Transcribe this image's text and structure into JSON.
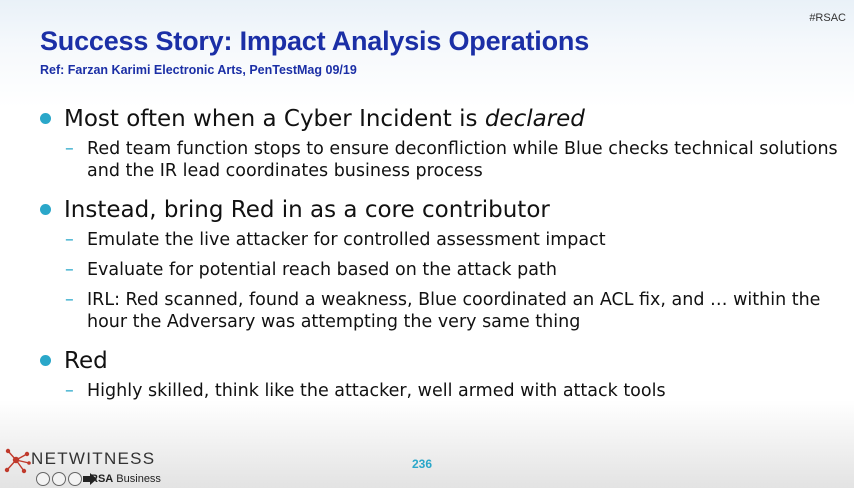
{
  "header": {
    "hashtag": "#RSAC",
    "title": "Success Story: Impact Analysis Operations",
    "reference": "Ref: Farzan Karimi Electronic Arts, PenTestMag 09/19"
  },
  "bullets": [
    {
      "text_before": "Most often when a Cyber Incident is ",
      "text_italic": "declared",
      "subs": [
        "Red team function stops to ensure deconfliction while Blue checks technical solutions and the IR lead coordinates business process"
      ]
    },
    {
      "text_before": "Instead, bring Red in as a core contributor",
      "text_italic": "",
      "subs": [
        "Emulate the live attacker for controlled assessment impact",
        "Evaluate for potential reach based on the attack path",
        "IRL: Red scanned, found a weakness, Blue coordinated an ACL fix, and … within the hour the Adversary was attempting the very same thing"
      ]
    },
    {
      "text_before": "Red",
      "text_italic": "",
      "subs": [
        "Highly skilled, think like the attacker, well armed with attack tools"
      ]
    }
  ],
  "footer": {
    "page_number": "236",
    "logo_text": "NETWITNESS",
    "rsa_brand": "RSA",
    "rsa_suffix": "Business"
  },
  "colors": {
    "title": "#1b2fa6",
    "accent": "#2aa7c9",
    "logo_red": "#c0392b"
  },
  "icons": {
    "bullet": "circle-bullet-icon",
    "sub_bullet": "dash-bullet-icon",
    "logo": "netwitness-network-icon"
  }
}
